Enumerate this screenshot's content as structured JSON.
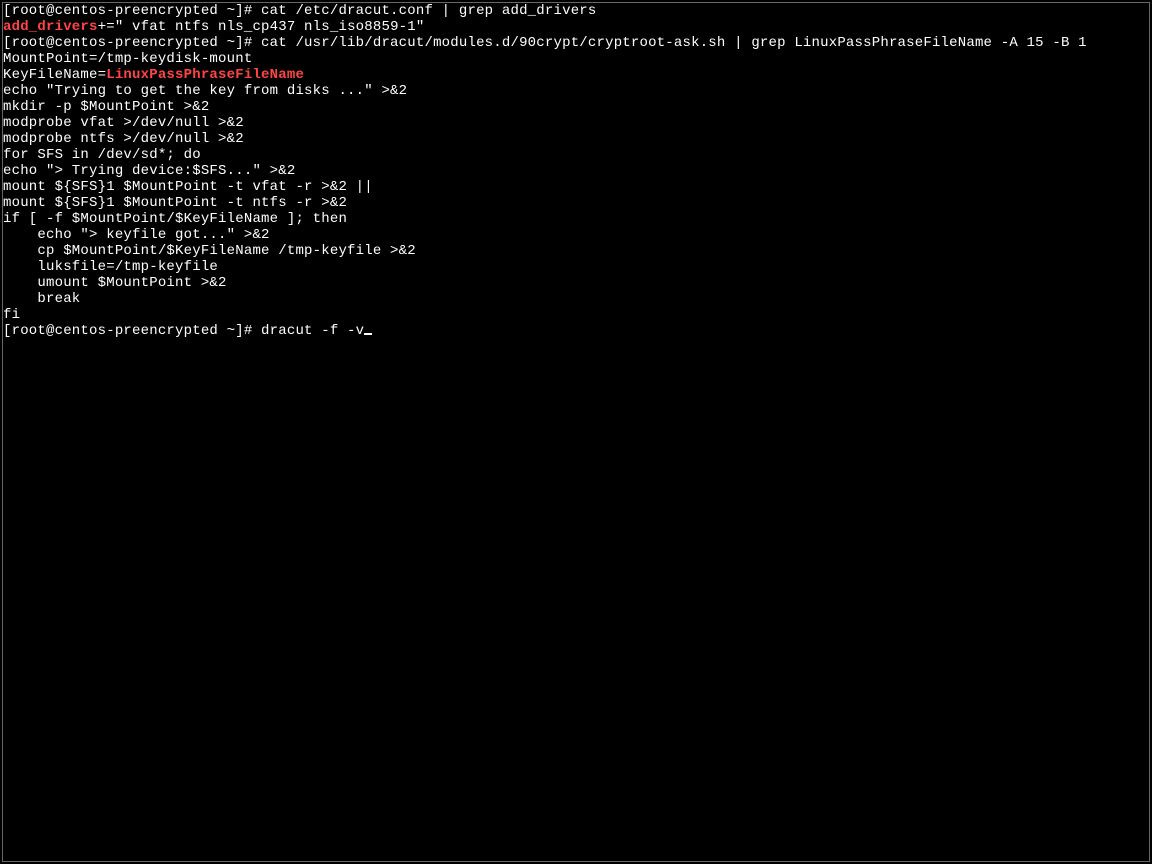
{
  "lines": [
    {
      "segments": [
        {
          "t": "[root@centos-preencrypted ~]# cat /etc/dracut.conf | grep add_drivers"
        }
      ]
    },
    {
      "segments": [
        {
          "t": "add_drivers",
          "hl": true
        },
        {
          "t": "+=\" vfat ntfs nls_cp437 nls_iso8859-1\""
        }
      ]
    },
    {
      "segments": [
        {
          "t": "[root@centos-preencrypted ~]# cat /usr/lib/dracut/modules.d/90crypt/cryptroot-ask.sh | grep LinuxPassPhraseFileName -A 15 -B 1"
        }
      ]
    },
    {
      "segments": [
        {
          "t": "MountPoint=/tmp-keydisk-mount"
        }
      ]
    },
    {
      "segments": [
        {
          "t": "KeyFileName="
        },
        {
          "t": "LinuxPassPhraseFileName",
          "hl": true
        }
      ]
    },
    {
      "segments": [
        {
          "t": "echo \"Trying to get the key from disks ...\" >&2"
        }
      ]
    },
    {
      "segments": [
        {
          "t": "mkdir -p $MountPoint >&2"
        }
      ]
    },
    {
      "segments": [
        {
          "t": "modprobe vfat >/dev/null >&2"
        }
      ]
    },
    {
      "segments": [
        {
          "t": "modprobe ntfs >/dev/null >&2"
        }
      ]
    },
    {
      "segments": [
        {
          "t": "for SFS in /dev/sd*; do"
        }
      ]
    },
    {
      "segments": [
        {
          "t": "echo \"> Trying device:$SFS...\" >&2"
        }
      ]
    },
    {
      "segments": [
        {
          "t": "mount ${SFS}1 $MountPoint -t vfat -r >&2 ||"
        }
      ]
    },
    {
      "segments": [
        {
          "t": "mount ${SFS}1 $MountPoint -t ntfs -r >&2"
        }
      ]
    },
    {
      "segments": [
        {
          "t": "if [ -f $MountPoint/$KeyFileName ]; then"
        }
      ]
    },
    {
      "segments": [
        {
          "t": "    echo \"> keyfile got...\" >&2"
        }
      ]
    },
    {
      "segments": [
        {
          "t": "    cp $MountPoint/$KeyFileName /tmp-keyfile >&2"
        }
      ]
    },
    {
      "segments": [
        {
          "t": "    luksfile=/tmp-keyfile"
        }
      ]
    },
    {
      "segments": [
        {
          "t": "    umount $MountPoint >&2"
        }
      ]
    },
    {
      "segments": [
        {
          "t": "    break"
        }
      ]
    },
    {
      "segments": [
        {
          "t": "fi"
        }
      ]
    },
    {
      "segments": [
        {
          "t": "[root@centos-preencrypted ~]# dracut -f -v"
        }
      ],
      "cursor": true
    }
  ]
}
